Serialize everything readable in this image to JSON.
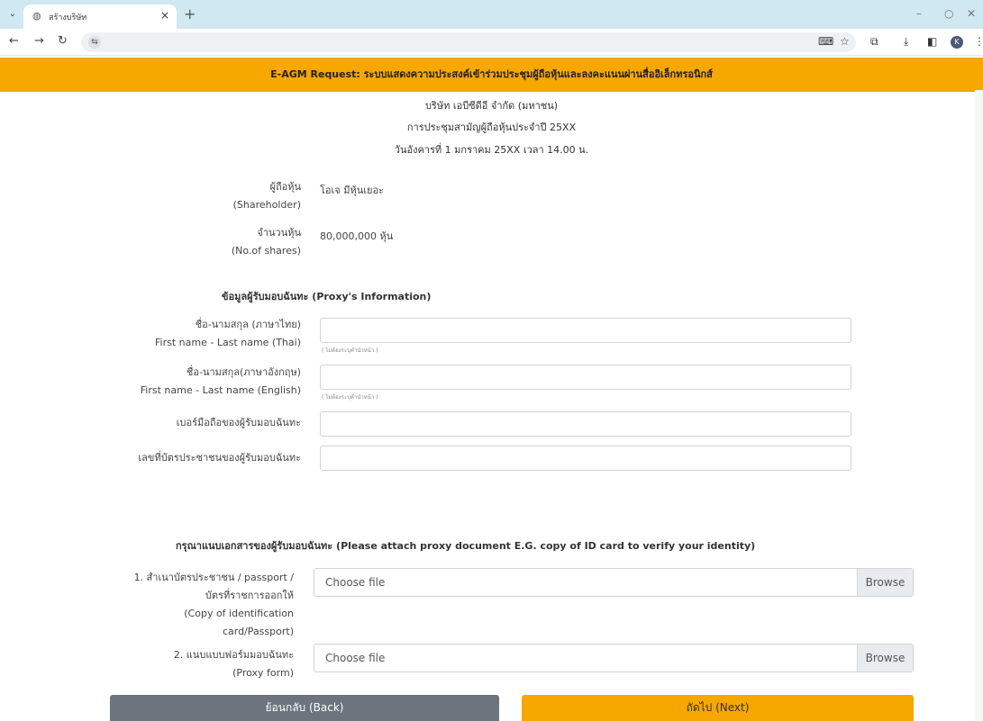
{
  "browser": {
    "tab_title": "สร้างบริษัท",
    "tab_close": "×",
    "new_tab": "+",
    "minimize": "–",
    "restore": "○",
    "close": "✕",
    "url": "",
    "profile_initial": "K"
  },
  "page": {
    "banner": "E-AGM Request: ระบบแสดงความประสงค์เข้าร่วมประชุมผู้ถือหุ้นและลงคะแนนผ่านสื่ออิเล็กทรอนิกส์",
    "company": "บริษัท เอบีซีดีอี จำกัด (มหาชน)",
    "meeting": "การประชุมสามัญผู้ถือหุ้นประจำปี 25XX",
    "date": "วันอังคารที่ 1 มกราคม 25XX เวลา 14.00 น."
  },
  "shareholder": {
    "label_th": "ผู้ถือหุ้น",
    "label_en": "(Shareholder)",
    "value": "โอเจ มีหุ้นเยอะ"
  },
  "shares": {
    "label_th": "จำนวนหุ้น",
    "label_en": "(No.of shares)",
    "value": "80,000,000 หุ้น"
  },
  "proxy": {
    "title": "ข้อมูลผู้รับมอบฉันทะ (Proxy's Information)",
    "name_th_label_th": "ชื่อ-นามสกุล (ภาษาไทย)",
    "name_th_label_en": "First name - Last name (Thai)",
    "name_th_hint": "( ไม่ต้องระบุคำนำหน้า )",
    "name_en_label_th": "ชื่อ-นามสกุล(ภาษาอังกฤษ)",
    "name_en_label_en": "First name - Last name (English)",
    "name_en_hint": "( ไม่ต้องระบุคำนำหน้า )",
    "phone_label": "เบอร์มือถือของผู้รับมอบฉันทะ",
    "id_label": "เลขที่บัตรประชาชนของผู้รับมอบฉันทะ"
  },
  "attach": {
    "title": "กรุณาแนบเอกสารของผู้รับมอบฉันทะ (Please attach proxy document E.G. copy of ID card to verify your identity)",
    "doc1_line1": "1. สำเนาบัตรประชาชน / passport /",
    "doc1_line2": "บัตรที่ราชการออกให้",
    "doc1_line3": "(Copy of identification",
    "doc1_line4": "card/Passport)",
    "doc2_line1": "2. แนบแบบฟอร์มมอบฉันทะ",
    "doc2_line2": "(Proxy form)",
    "choose_file": "Choose file",
    "browse": "Browse"
  },
  "buttons": {
    "back": "ย้อนกลับ (Back)",
    "next": "ถัดไป (Next)"
  }
}
